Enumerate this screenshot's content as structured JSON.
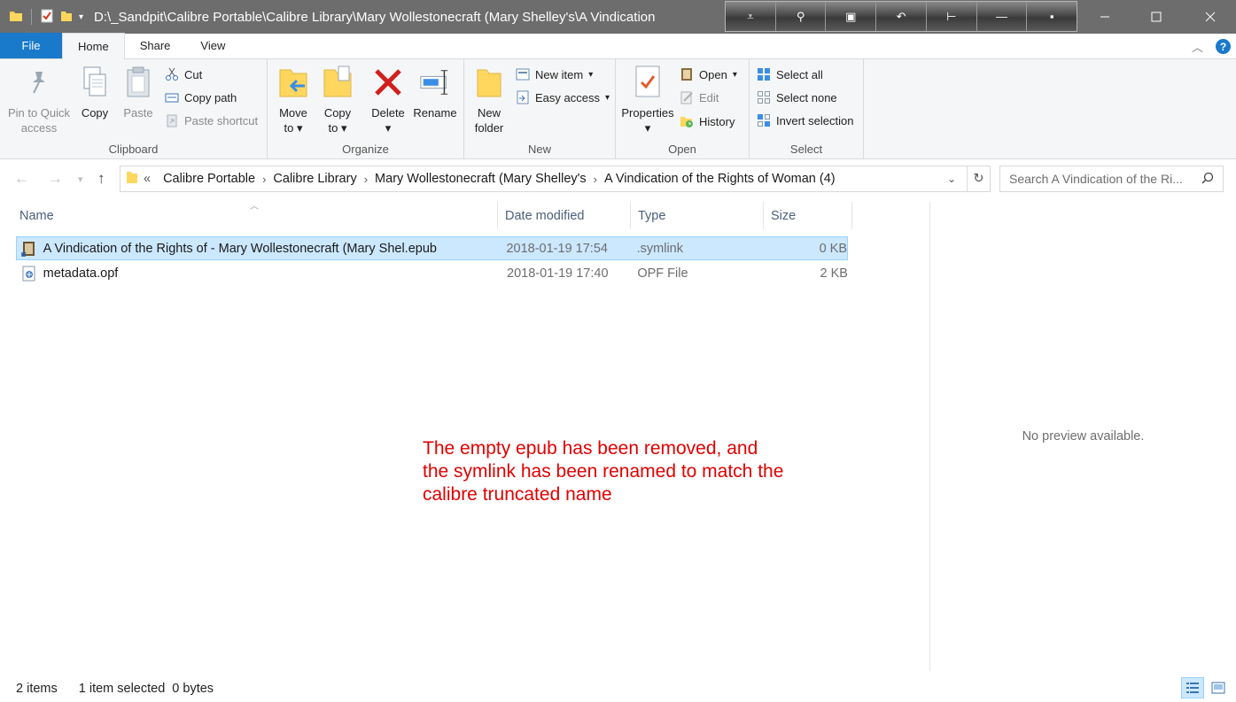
{
  "titlebar": {
    "path": "D:\\_Sandpit\\Calibre Portable\\Calibre Library\\Mary Wollestonecraft (Mary Shelley's\\A Vindication",
    "qat_icons": [
      "folder-icon",
      "properties-icon",
      "new-folder-icon",
      "customize-qat-icon"
    ],
    "tool_strip": [
      "collapse-icon",
      "pin-icon",
      "restore-icon",
      "undo-icon",
      "tack-icon",
      "minimize-line-icon",
      "dot-icon"
    ]
  },
  "tabs": {
    "file": "File",
    "home": "Home",
    "share": "Share",
    "view": "View"
  },
  "ribbon": {
    "clipboard": {
      "label": "Clipboard",
      "pin_line1": "Pin to Quick",
      "pin_line2": "access",
      "copy": "Copy",
      "paste": "Paste",
      "cut": "Cut",
      "copy_path": "Copy path",
      "paste_shortcut": "Paste shortcut"
    },
    "organize": {
      "label": "Organize",
      "move_line1": "Move",
      "move_line2": "to",
      "copy_line1": "Copy",
      "copy_line2": "to",
      "delete": "Delete",
      "rename": "Rename"
    },
    "new": {
      "label": "New",
      "folder_line1": "New",
      "folder_line2": "folder",
      "new_item": "New item",
      "easy_access": "Easy access"
    },
    "open": {
      "label": "Open",
      "properties": "Properties",
      "open": "Open",
      "edit": "Edit",
      "history": "History"
    },
    "select": {
      "label": "Select",
      "select_all": "Select all",
      "select_none": "Select none",
      "invert": "Invert selection"
    }
  },
  "address": {
    "overflow": "«",
    "crumbs": [
      "Calibre Portable",
      "Calibre Library",
      "Mary Wollestonecraft (Mary Shelley's",
      "A Vindication of the Rights of Woman (4)"
    ],
    "search_placeholder": "Search A Vindication of the Ri..."
  },
  "columns": {
    "name": "Name",
    "date": "Date modified",
    "type": "Type",
    "size": "Size"
  },
  "files": [
    {
      "name": "A Vindication of the Rights of - Mary Wollestonecraft (Mary Shel.epub",
      "date": "2018-01-19 17:54",
      "type": ".symlink",
      "size": "0 KB",
      "selected": true
    },
    {
      "name": "metadata.opf",
      "date": "2018-01-19 17:40",
      "type": "OPF File",
      "size": "2 KB",
      "selected": false
    }
  ],
  "preview": {
    "text": "No preview available."
  },
  "annotation": {
    "line1": "The empty epub has been removed, and",
    "line2": "the symlink has been renamed to match the",
    "line3": "calibre truncated name"
  },
  "status": {
    "items": "2 items",
    "selected": "1 item selected",
    "bytes": "0 bytes"
  },
  "colors": {
    "titlebar": "#6d6d6d",
    "file_tab": "#1979ca",
    "selection": "#cce8ff",
    "annotation": "#e00000"
  }
}
